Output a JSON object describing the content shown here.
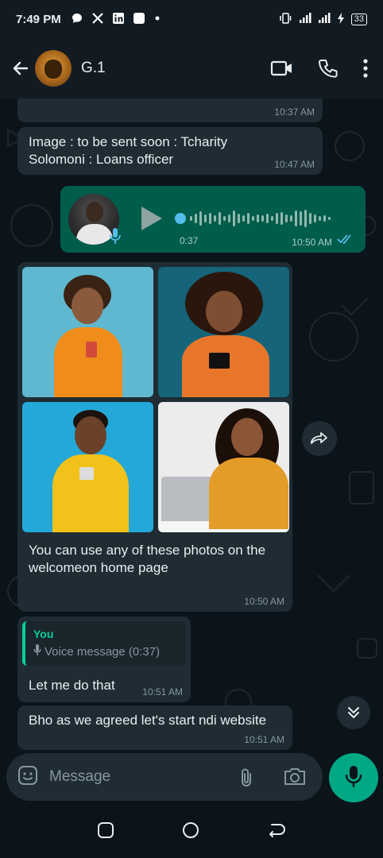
{
  "status_bar": {
    "time": "7:49 PM",
    "battery": "33",
    "left_icons": [
      "chat-bubble-icon",
      "x-logo-icon",
      "linkedin-icon",
      "square-icon",
      "dot-icon"
    ],
    "right_icons": [
      "vibrate-icon",
      "signal-icon",
      "signal-icon",
      "charging-icon",
      "battery-icon"
    ]
  },
  "header": {
    "contact_name": "G.1",
    "icons": [
      "back-arrow-icon",
      "video-call-icon",
      "phone-icon",
      "more-vert-icon"
    ]
  },
  "messages": [
    {
      "type": "text",
      "direction": "in",
      "text": "Image : to be sent soon : Tcharity",
      "text2": "Solomoni : Loans officer",
      "time": "10:47 AM"
    },
    {
      "type": "voice",
      "direction": "out",
      "duration": "0:37",
      "time": "10:50 AM",
      "read": true
    },
    {
      "type": "photos",
      "direction": "in",
      "caption_line1": "You can use any of these photos on the",
      "caption_line2": "welcomeon home page",
      "time": "10:50 AM",
      "photo_count": 4
    },
    {
      "type": "reply",
      "direction": "in",
      "quote_author": "You",
      "quote_text": "Voice message (0:37)",
      "text": "Let me do that",
      "time": "10:51 AM"
    },
    {
      "type": "text",
      "direction": "in",
      "text": "Bho as we agreed let's start ndi website",
      "time": "10:51 AM"
    }
  ],
  "previous_time": "10:37 AM",
  "input": {
    "placeholder": "Message"
  },
  "colors": {
    "background": "#0b141a",
    "incoming_bubble": "#1f2c34",
    "outgoing_bubble": "#005c4b",
    "accent": "#00a884",
    "read_ticks": "#53bdeb"
  }
}
